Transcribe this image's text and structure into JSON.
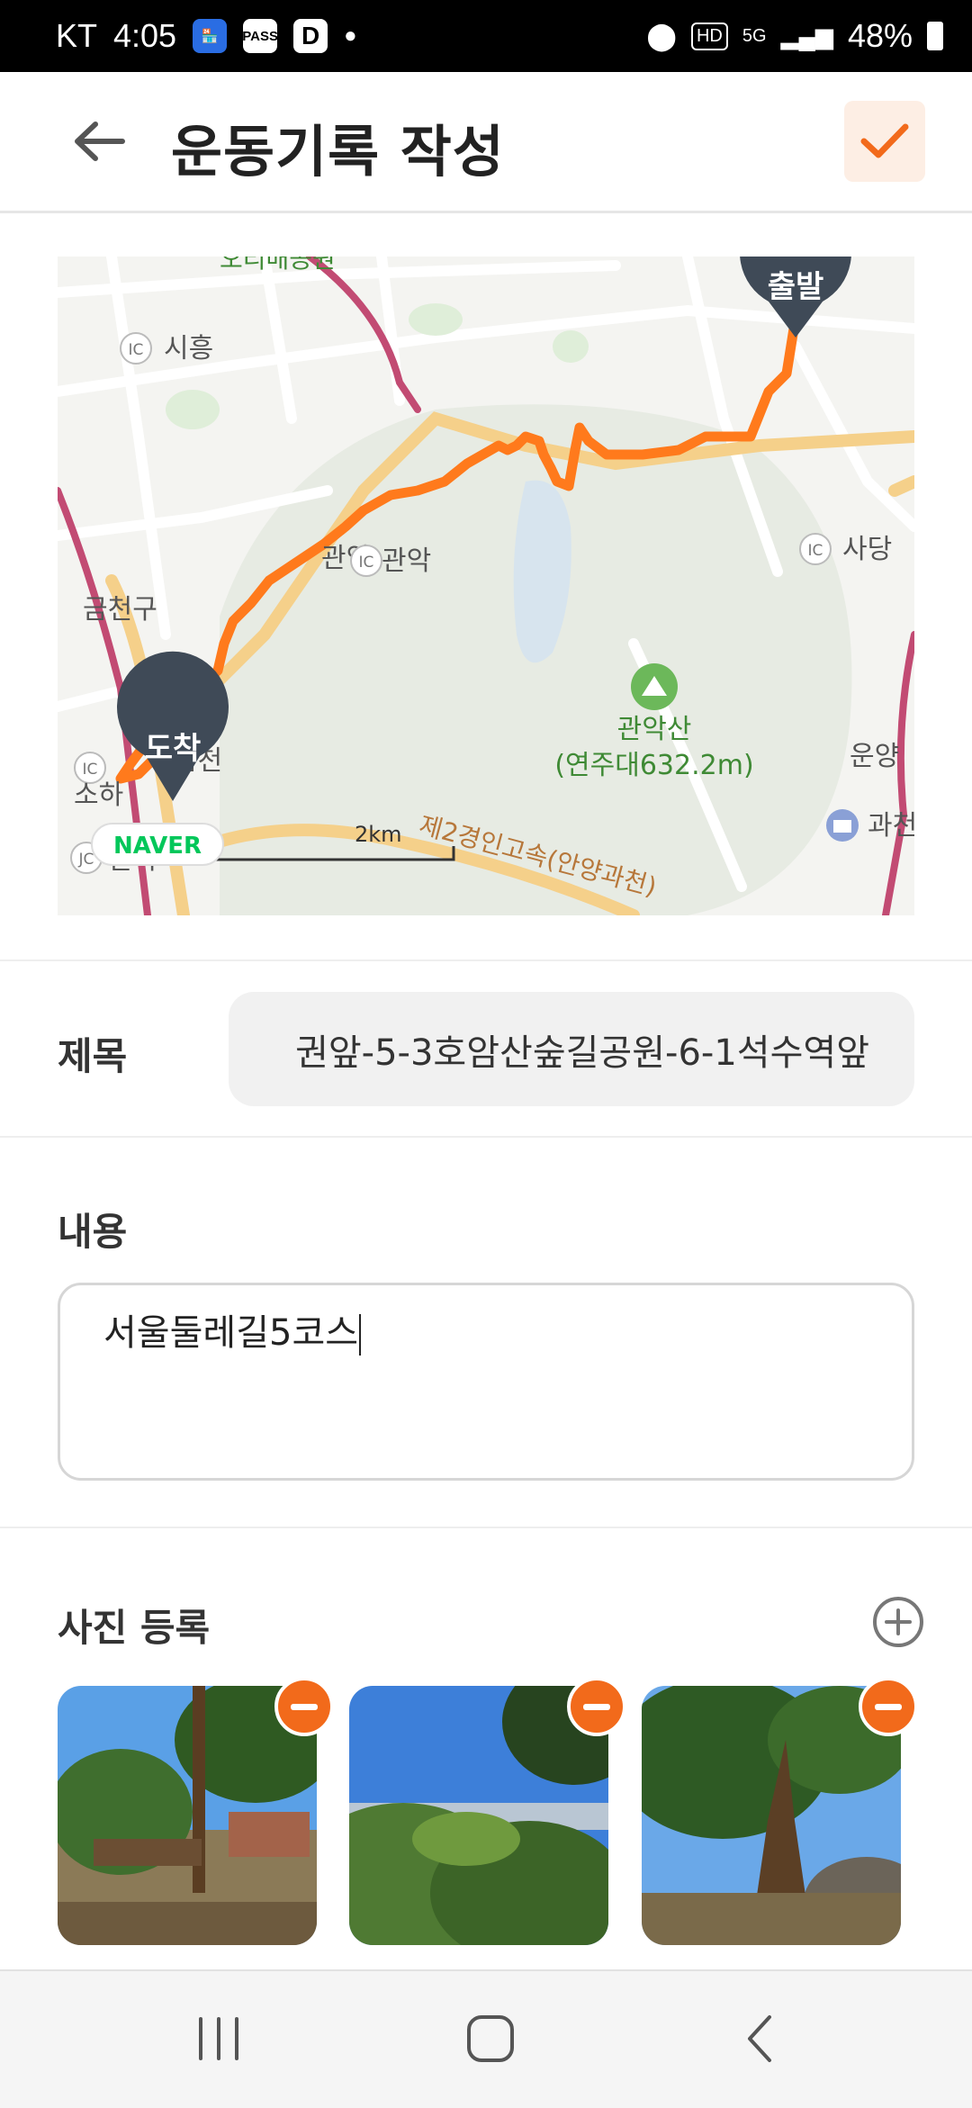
{
  "status_bar": {
    "carrier": "KT",
    "time": "4:05",
    "app_icons": [
      "shopping-icon",
      "PASS",
      "D"
    ],
    "network": "5G",
    "hd_label": "HD",
    "battery": "48%"
  },
  "app_bar": {
    "title": "운동기록 작성",
    "accent_color": "#f26a1b"
  },
  "map": {
    "start_label": "출발",
    "end_label": "도착",
    "mountain_name": "관악산",
    "mountain_elevation": "(연주대632.2m)",
    "scale_zero": "0",
    "scale_end": "2km",
    "place_labels": {
      "siheung": "시흥",
      "sadang": "사당",
      "gwanak_ic": "관악",
      "gwanak_area": "관악",
      "geumcheon_gu": "금천구",
      "geumcheon": "금천",
      "soha": "소하",
      "iljik": "일직",
      "gwacheon": "과천",
      "unyang": "운양",
      "road": "제2경인고속(안양과천)",
      "top_partial": "오리배공원"
    },
    "ic_badge": "IC",
    "jc_badge": "JC",
    "brand": "NAVER",
    "route_color": "#ff7a1c"
  },
  "form": {
    "title_label": "제목",
    "title_value": "권앞-5-3호암산숲길공원-6-1석수역앞",
    "content_label": "내용",
    "content_value": "서울둘레길5코스",
    "photo_label": "사진 등록"
  },
  "photos": [
    {
      "name": "photo-1"
    },
    {
      "name": "photo-2"
    },
    {
      "name": "photo-3"
    }
  ]
}
